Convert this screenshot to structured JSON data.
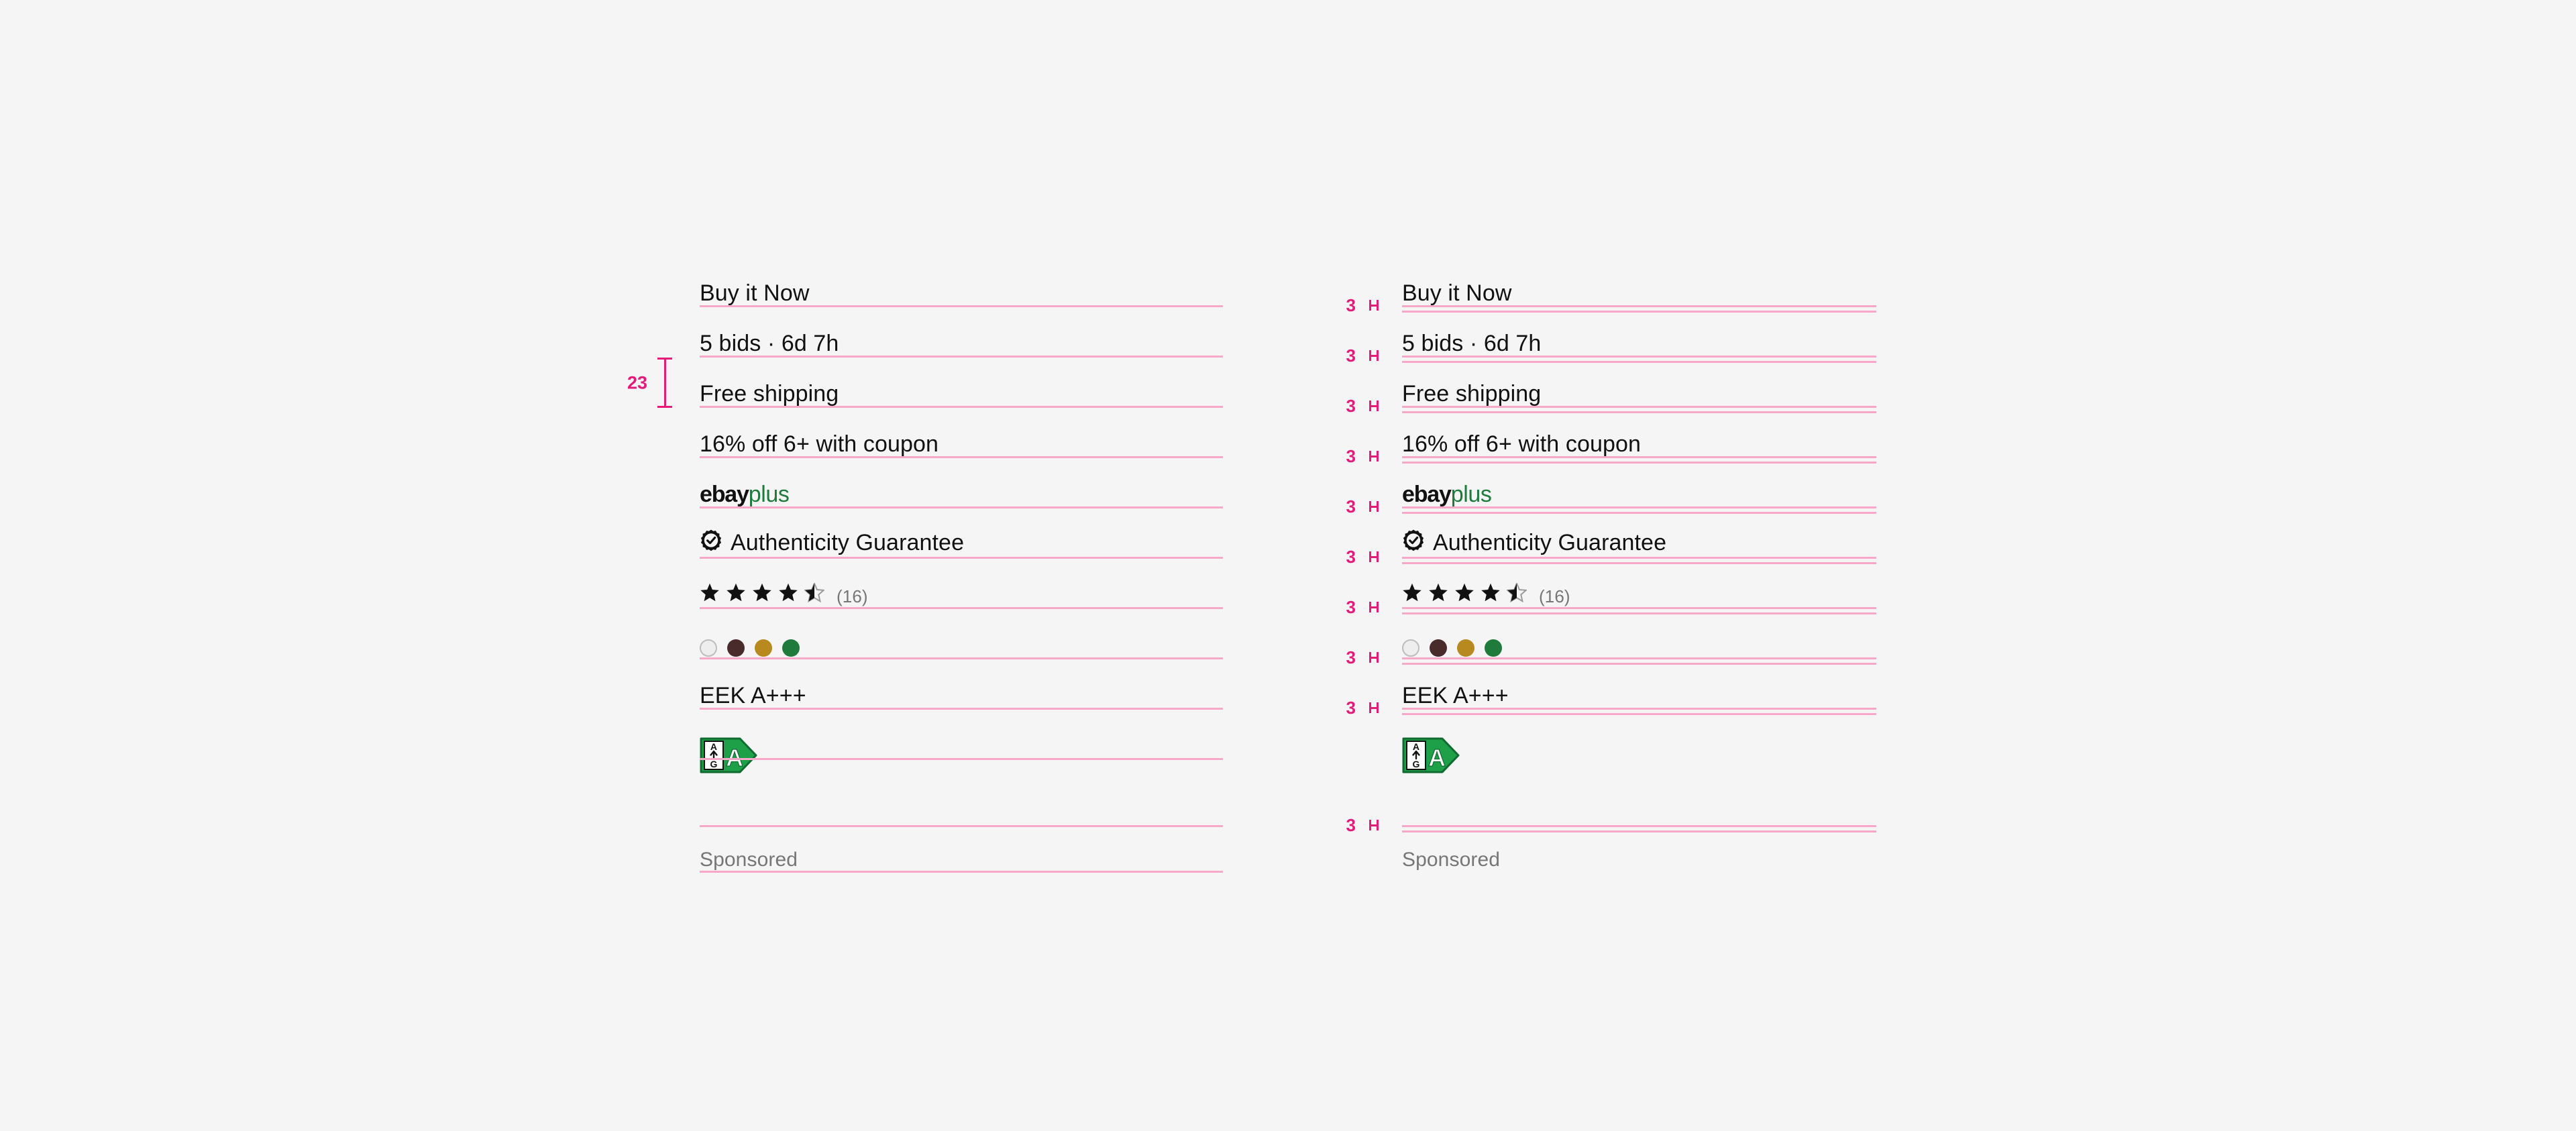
{
  "page": {
    "background_color": "#f5f5f5",
    "rule_color": "#f7a8c8",
    "annotation_color": "#e31c79",
    "text_color": "#111111",
    "muted_text_color": "#767676"
  },
  "rows": [
    {
      "id": "buy-it-now",
      "type": "text",
      "label": "Buy it Now"
    },
    {
      "id": "bids-time",
      "type": "text",
      "label": "5 bids · 6d 7h"
    },
    {
      "id": "free-shipping",
      "type": "text",
      "label": "Free shipping"
    },
    {
      "id": "coupon",
      "type": "text",
      "label": "16% off 6+ with coupon"
    },
    {
      "id": "ebay-plus",
      "type": "wordmark",
      "label": "ebayplus",
      "parts": {
        "first": "ebay",
        "second": "plus",
        "second_color": "#1e7b3c"
      }
    },
    {
      "id": "authenticity",
      "type": "badge-text",
      "label": "Authenticity Guarantee",
      "icon": "authenticity-guarantee-icon"
    },
    {
      "id": "rating",
      "type": "rating",
      "label": "(16)",
      "stars_filled": 4,
      "stars_half": 1,
      "stars_total": 5,
      "review_count": "(16)"
    },
    {
      "id": "swatches",
      "type": "swatches",
      "colors": [
        "#eeeeee",
        "#4a2b2b",
        "#b8891f",
        "#1e7b3c"
      ]
    },
    {
      "id": "eek",
      "type": "text",
      "label": "EEK A+++"
    },
    {
      "id": "energy-label",
      "type": "energy",
      "grade": "A",
      "scale_top": "A",
      "scale_bottom": "G"
    },
    {
      "id": "divider",
      "type": "divider"
    },
    {
      "id": "sponsored",
      "type": "text",
      "label": "Sponsored",
      "muted": true
    }
  ],
  "left_column": {
    "measurement": {
      "value": "23",
      "unit_hint": "px",
      "spans_from_row": "bids-time",
      "spans_to_row": "free-shipping"
    }
  },
  "right_column": {
    "measurements": [
      {
        "value": "3",
        "after_row": "buy-it-now"
      },
      {
        "value": "3",
        "after_row": "bids-time"
      },
      {
        "value": "3",
        "after_row": "free-shipping"
      },
      {
        "value": "3",
        "after_row": "coupon"
      },
      {
        "value": "3",
        "after_row": "ebay-plus"
      },
      {
        "value": "3",
        "after_row": "authenticity"
      },
      {
        "value": "3",
        "after_row": "rating"
      },
      {
        "value": "3",
        "after_row": "swatches"
      },
      {
        "value": "3",
        "after_row": "eek"
      },
      {
        "value": "3",
        "after_row": "divider"
      }
    ]
  }
}
